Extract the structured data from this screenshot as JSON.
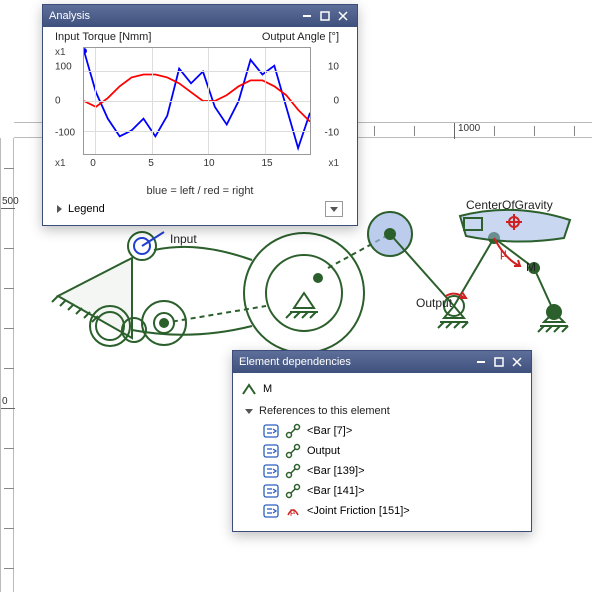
{
  "analysis_panel": {
    "title": "Analysis",
    "left_axis_label": "Input Torque [Nmm]",
    "right_axis_label": "Output Angle [°]",
    "mult_tl": "x1",
    "mult_bl": "x1",
    "mult_br": "x1",
    "subtitle": "blue = left / red = right",
    "legend_label": "Legend",
    "y_left_ticks": [
      "100",
      "0",
      "-100"
    ],
    "y_right_ticks": [
      "10",
      "0",
      "-10"
    ],
    "x_ticks": [
      "0",
      "5",
      "10",
      "15"
    ]
  },
  "chart_data": {
    "type": "line",
    "title": "Input Torque [Nmm] / Output Angle [°]",
    "xlabel": "",
    "ylabel_left": "Input Torque [Nmm]",
    "ylabel_right": "Output Angle [°]",
    "xlim": [
      0,
      19
    ],
    "ylim_left": [
      -180,
      180
    ],
    "ylim_right": [
      -18,
      18
    ],
    "subtitle": "blue = left / red = right",
    "series": [
      {
        "name": "Input Torque",
        "axis": "left",
        "color": "#0000ff",
        "x": [
          0,
          1,
          2,
          3,
          4,
          5,
          6,
          7,
          8,
          9,
          10,
          11,
          12,
          13,
          14,
          15,
          16,
          17,
          18,
          19
        ],
        "values": [
          170,
          30,
          -60,
          -120,
          -100,
          -60,
          -120,
          -50,
          110,
          60,
          100,
          -20,
          -80,
          0,
          140,
          90,
          120,
          -20,
          -160,
          -40
        ]
      },
      {
        "name": "Output Angle",
        "axis": "right",
        "color": "#ff0000",
        "x": [
          0,
          1,
          2,
          3,
          4,
          5,
          6,
          7,
          8,
          9,
          10,
          11,
          12,
          13,
          14,
          15,
          16,
          17,
          18,
          19
        ],
        "values": [
          0,
          -2,
          1,
          5,
          8,
          9,
          9,
          8,
          6,
          3,
          0,
          0,
          2,
          5,
          7,
          7,
          5,
          2,
          -3,
          -7
        ]
      }
    ]
  },
  "ruler_top": {
    "major": "1000"
  },
  "ruler_left": {
    "majors": [
      "500",
      "0"
    ]
  },
  "mechanism_labels": {
    "input": "Input",
    "output": "Output",
    "cog": "CenterOfGravity",
    "m": "M",
    "mu": "µ"
  },
  "deps_panel": {
    "title": "Element dependencies",
    "element_name": "M",
    "section": "References to this element",
    "refs": [
      {
        "icon": "bar-icon",
        "label": "<Bar [7]>"
      },
      {
        "icon": "bar-icon",
        "label": "Output"
      },
      {
        "icon": "bar-icon",
        "label": "<Bar [139]>"
      },
      {
        "icon": "bar-icon",
        "label": "<Bar [141]>"
      },
      {
        "icon": "friction-icon",
        "label": "<Joint Friction [151]>"
      }
    ]
  }
}
